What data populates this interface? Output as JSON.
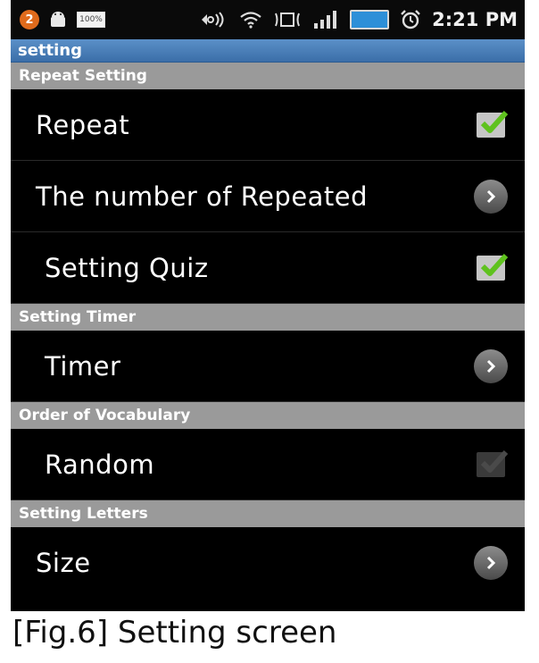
{
  "status_bar": {
    "notification_count": "2",
    "battery_small": "100%",
    "time": "2:21 PM",
    "icons": [
      "notification-badge-icon",
      "android-icon",
      "battery-small-icon",
      "headset-icon",
      "wifi-icon",
      "data-icon",
      "signal-icon",
      "battery-icon",
      "alarm-icon"
    ]
  },
  "title_bar": {
    "title": "setting"
  },
  "sections": [
    {
      "header": "Repeat Setting",
      "items": [
        {
          "label": "Repeat",
          "control": "checkbox",
          "checked": true
        },
        {
          "label": "The number of Repeated",
          "control": "chevron"
        },
        {
          "label": "Setting Quiz",
          "control": "checkbox",
          "checked": true
        }
      ]
    },
    {
      "header": "Setting Timer",
      "items": [
        {
          "label": "Timer",
          "control": "chevron"
        }
      ]
    },
    {
      "header": "Order of Vocabulary",
      "items": [
        {
          "label": "Random",
          "control": "checkbox",
          "checked": false
        }
      ]
    },
    {
      "header": "Setting Letters",
      "items": [
        {
          "label": "Size",
          "control": "chevron"
        }
      ]
    }
  ],
  "colors": {
    "accent_green": "#5fc21e",
    "header_gray": "#9a9a9a",
    "title_blue": "#4a7fb8"
  },
  "caption": "[Fig.6] Setting screen"
}
